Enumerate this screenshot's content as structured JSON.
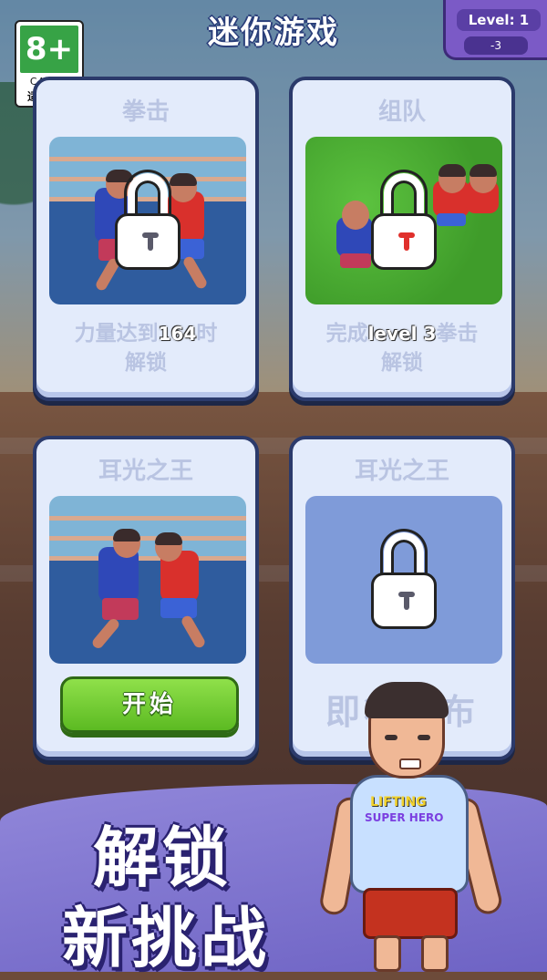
{
  "header": {
    "title": "迷你游戏"
  },
  "age_rating": {
    "age": "8+",
    "org": "CADPA",
    "label": "适龄提示"
  },
  "level_badge": {
    "level": "Level: 1",
    "cost": "-3"
  },
  "cards": [
    {
      "name": "拳击",
      "req_prefix": "力量达到",
      "req_value": "164",
      "req_suffix": "时",
      "req_line2": "解锁",
      "locked": true
    },
    {
      "name": "组队",
      "req_prefix": "完成",
      "req_value": "level 3",
      "req_suffix": "拳击",
      "req_line2": "解锁",
      "locked": true
    },
    {
      "name": "耳光之王",
      "start_label": "开始",
      "locked": false
    },
    {
      "name": "耳光之王",
      "coming_soon": "即将发布",
      "locked": true
    }
  ],
  "promo": {
    "line1": "解锁",
    "line2": "新挑战"
  },
  "hero_shirt": {
    "line1": "LIFTING",
    "line2": "SUPER HERO"
  },
  "colors": {
    "card_bg": "#e3ebfb",
    "card_border": "#2b3a6b",
    "start_green": "#5cba22",
    "promo_purple": "#6e63c4"
  }
}
